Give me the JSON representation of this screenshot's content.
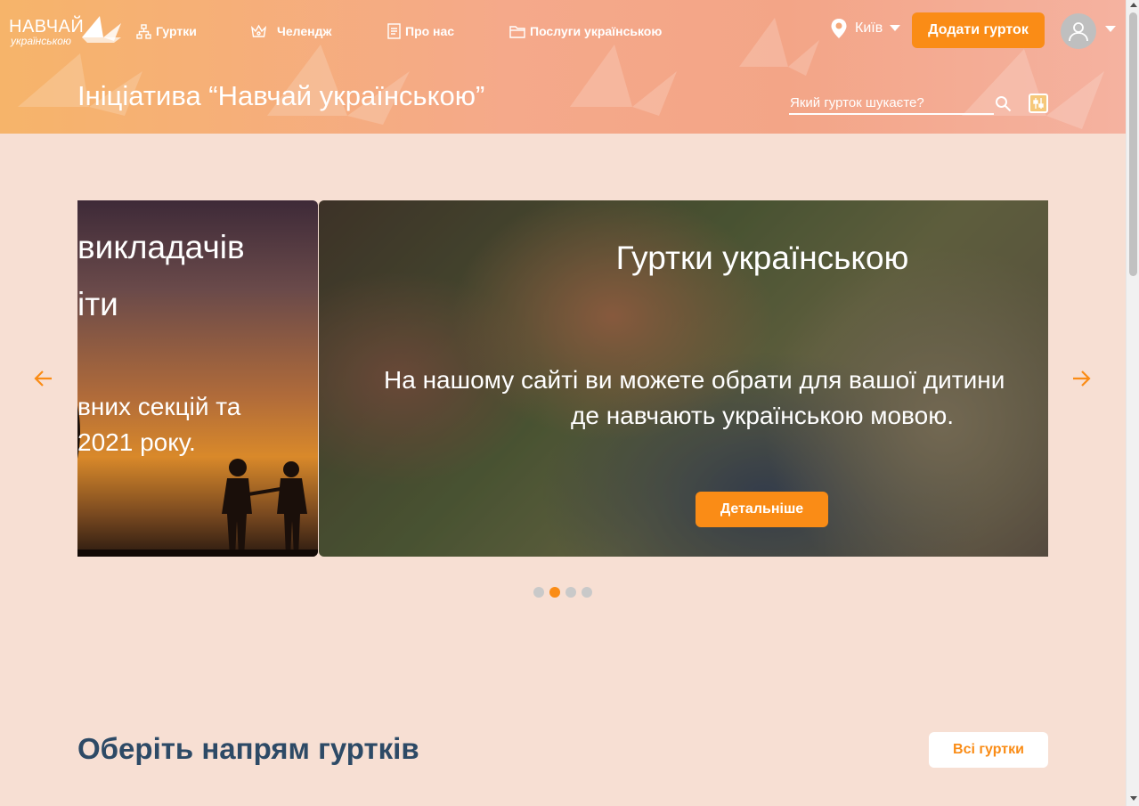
{
  "header": {
    "logo": {
      "line1": "НАВЧАЙ",
      "line2": "українською"
    },
    "nav": [
      {
        "label": "Гуртки",
        "icon": "sitemap-icon"
      },
      {
        "label": "Челендж",
        "icon": "crown-icon"
      },
      {
        "label": "Про нас",
        "icon": "document-icon"
      },
      {
        "label": "Послуги українською",
        "icon": "folder-icon"
      }
    ],
    "city": "Київ",
    "add_button": "Додати гурток",
    "page_title": "Ініціатива “Навчай українською”",
    "search_placeholder": "Який гурток шукаєте?",
    "colors": {
      "accent": "#fa8c16",
      "header_start": "#f6b46a",
      "header_end": "#f3a587"
    }
  },
  "carousel": {
    "prev_slide": {
      "title_line1": "викладачів",
      "title_line2": "іти",
      "desc_line1": "вних секцій та",
      "desc_line2": "2021 року."
    },
    "current_slide": {
      "title": "Гуртки українською",
      "desc_line1": "На нашому сайті ви можете обрати для вашої дитини",
      "desc_line2": "де навчають українською мовою.",
      "button": "Детальніше"
    },
    "dots_count": 4,
    "active_dot": 2
  },
  "section": {
    "title": "Оберіть напрям гуртків",
    "all_button": "Всі гуртки",
    "title_color": "#2d4a66"
  }
}
